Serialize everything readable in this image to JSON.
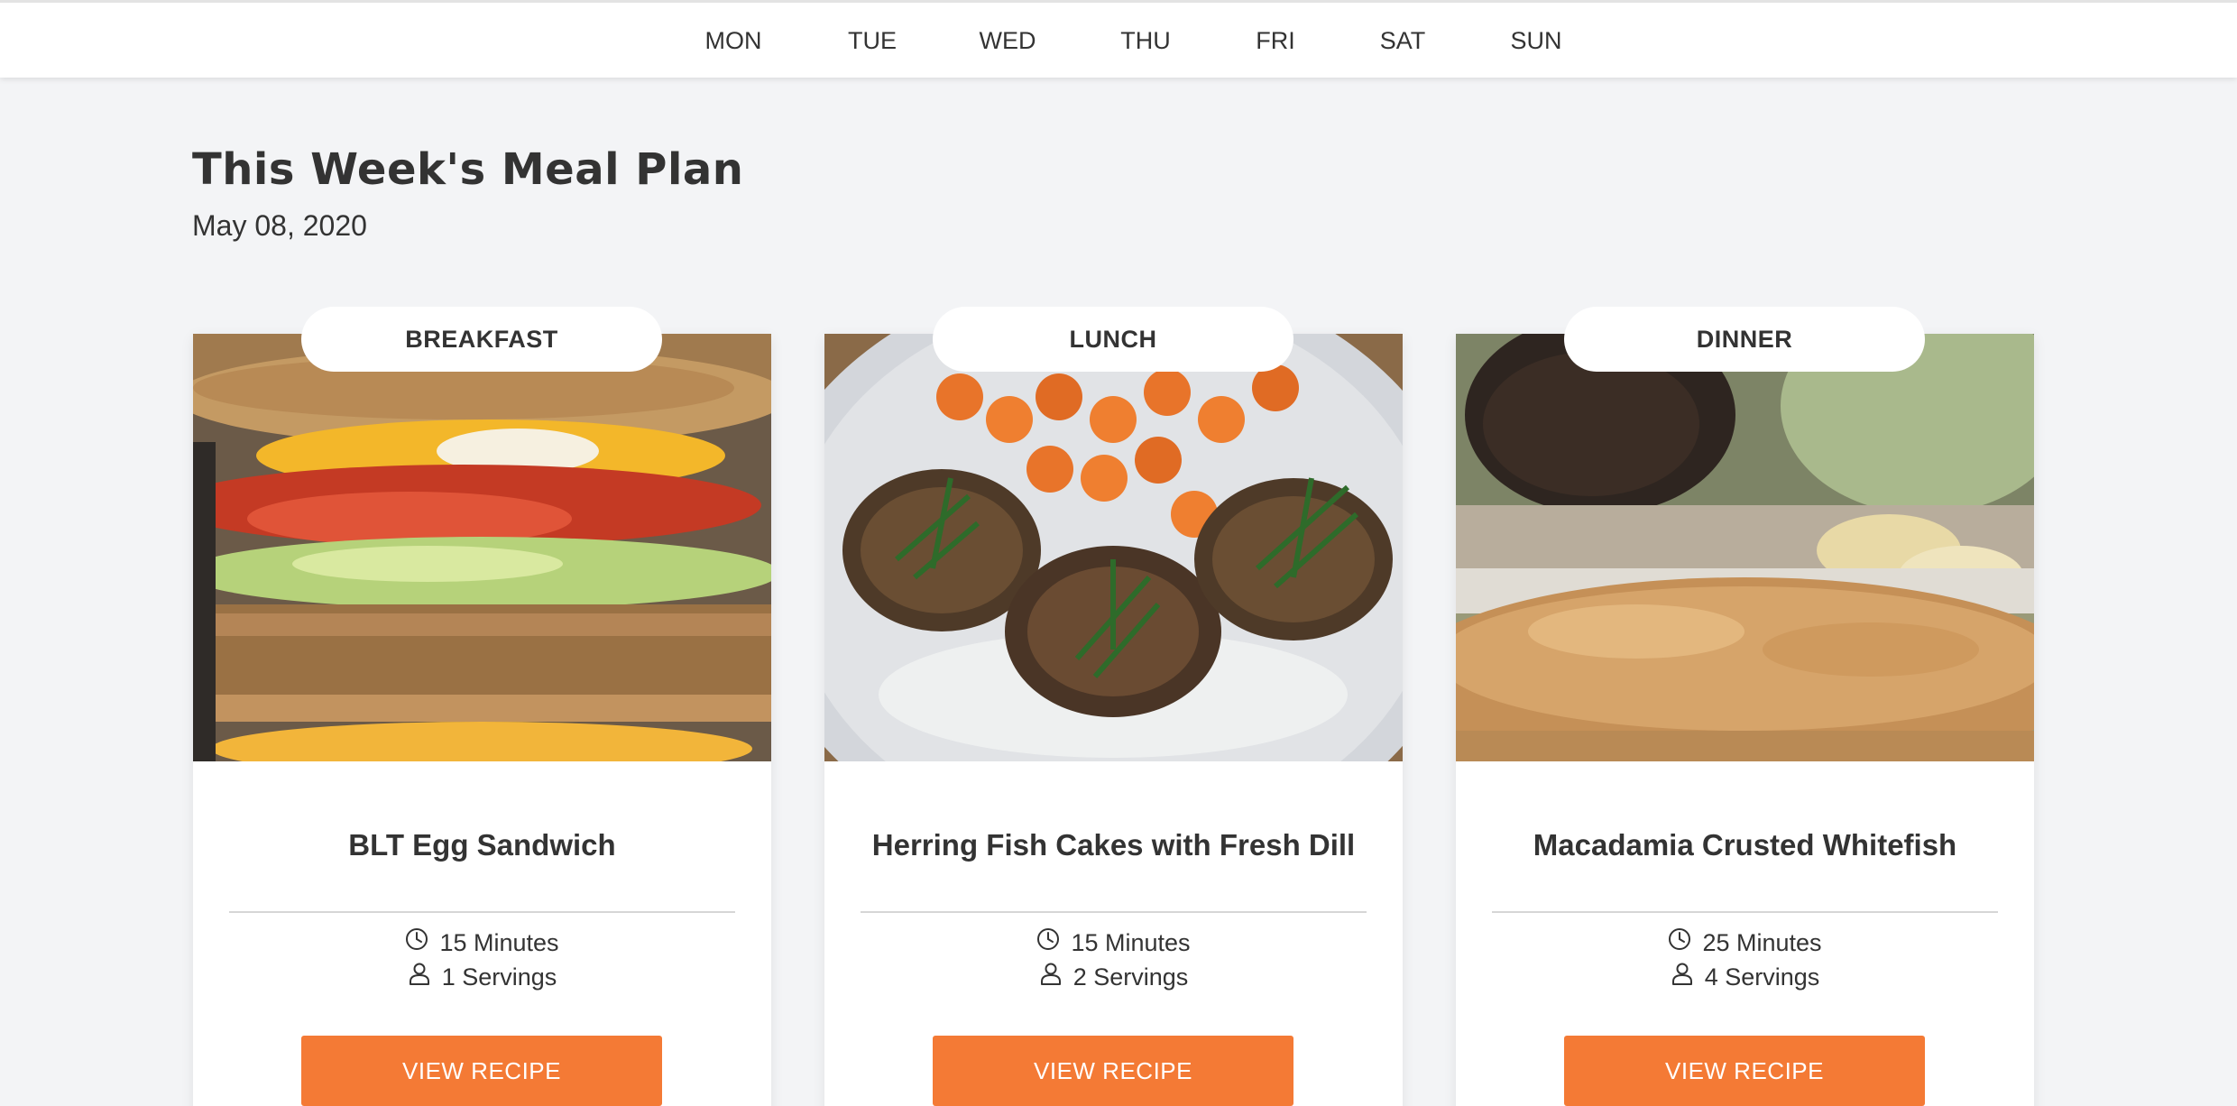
{
  "nav": {
    "days": [
      "MON",
      "TUE",
      "WED",
      "THU",
      "FRI",
      "SAT",
      "SUN"
    ]
  },
  "header": {
    "title": "This Week's Meal Plan",
    "date": "May 08, 2020"
  },
  "colors": {
    "accent": "#f47a35",
    "background": "#f3f4f6",
    "card": "#ffffff",
    "text": "#333333"
  },
  "cards": [
    {
      "meal": "BREAKFAST",
      "title": "BLT Egg Sandwich",
      "time": "15 Minutes",
      "servings": "1 Servings",
      "button": "VIEW RECIPE"
    },
    {
      "meal": "LUNCH",
      "title": "Herring Fish Cakes with Fresh Dill",
      "time": "15 Minutes",
      "servings": "2 Servings",
      "button": "VIEW RECIPE"
    },
    {
      "meal": "DINNER",
      "title": "Macadamia Crusted Whitefish",
      "time": "25 Minutes",
      "servings": "4 Servings",
      "button": "VIEW RECIPE"
    }
  ],
  "icons": {
    "time": "clock-icon",
    "servings": "person-icon"
  }
}
